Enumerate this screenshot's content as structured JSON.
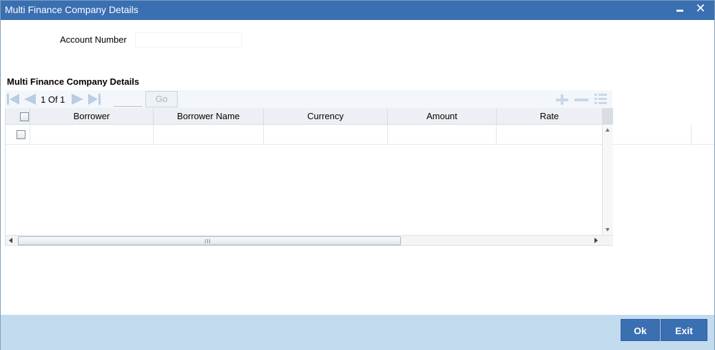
{
  "window": {
    "title": "Multi Finance Company Details",
    "close_glyph": "✕"
  },
  "form": {
    "account_number_label": "Account Number",
    "account_number_value": ""
  },
  "section": {
    "title": "Multi Finance Company Details"
  },
  "pager": {
    "page_text": "1 Of 1",
    "page_input_value": "",
    "go_label": "Go"
  },
  "toolbar_icons": [
    "first-page-icon",
    "previous-page-icon",
    "next-page-icon",
    "last-page-icon",
    "add-row-icon",
    "delete-row-icon",
    "single-view-icon"
  ],
  "grid": {
    "columns": [
      "Borrower",
      "Borrower Name",
      "Currency",
      "Amount",
      "Rate"
    ],
    "rows": [
      {
        "borrower": "",
        "borrower_name": "",
        "currency": "",
        "amount": "",
        "rate": ""
      }
    ],
    "scrollbar_grip": "III"
  },
  "footer": {
    "ok_label": "Ok",
    "exit_label": "Exit"
  },
  "colors": {
    "titlebar": "#3a6fb2",
    "footer": "#c3dbef",
    "button": "#3a6fb2",
    "nav_icon": "#b9cde4"
  }
}
